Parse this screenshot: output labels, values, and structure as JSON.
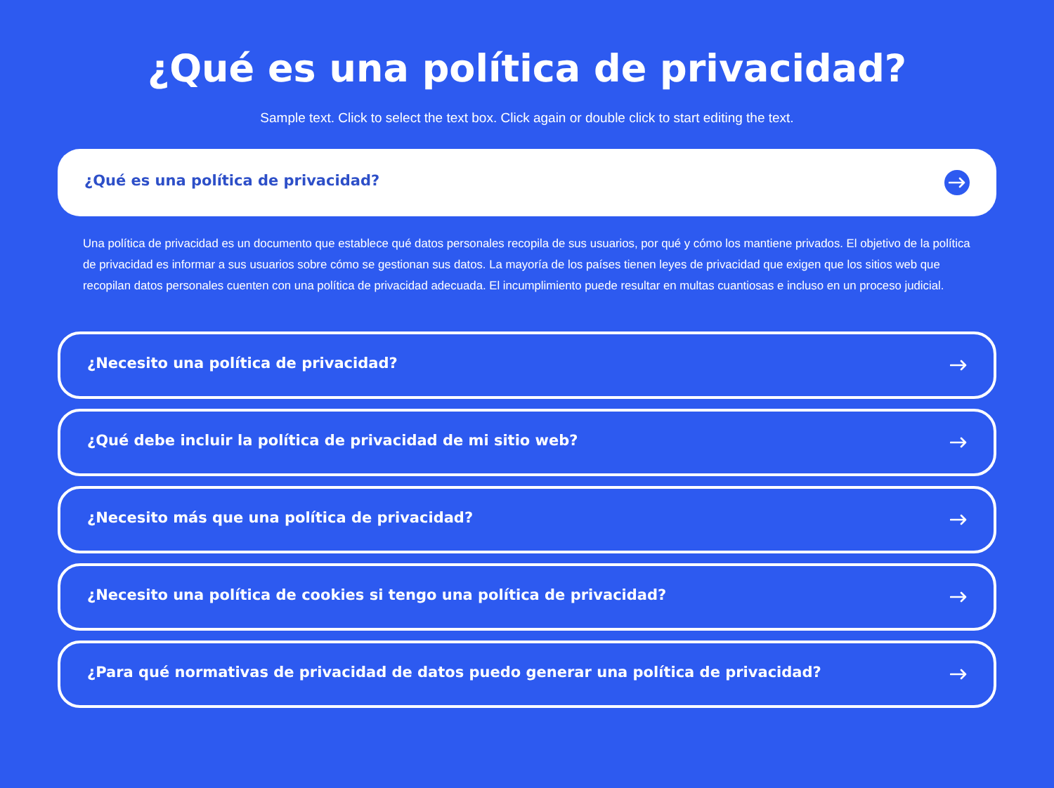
{
  "title": "¿Qué es una política de privacidad?",
  "subtitle": "Sample text. Click to select the text box. Click again or double click to start editing the text.",
  "faq": [
    {
      "question": "¿Qué es una política de privacidad?",
      "expanded": true,
      "answer": "Una política de privacidad es un documento que establece qué datos personales recopila de sus usuarios, por qué y cómo los mantiene privados. El objetivo de la política de privacidad es informar a sus usuarios sobre cómo se gestionan sus datos. La mayoría de los países tienen leyes de privacidad que exigen que los sitios web que recopilan datos personales cuenten con una política de privacidad adecuada. El incumplimiento puede resultar en multas cuantiosas e incluso en un proceso judicial."
    },
    {
      "question": "¿Necesito una política de privacidad?",
      "expanded": false
    },
    {
      "question": "¿Qué debe incluir la política de privacidad de mi sitio web?",
      "expanded": false
    },
    {
      "question": "¿Necesito más que una política de privacidad?",
      "expanded": false
    },
    {
      "question": "¿Necesito una política de cookies si tengo una política de privacidad?",
      "expanded": false
    },
    {
      "question": "¿Para qué normativas de privacidad de datos puedo generar una política de privacidad?",
      "expanded": false
    }
  ]
}
